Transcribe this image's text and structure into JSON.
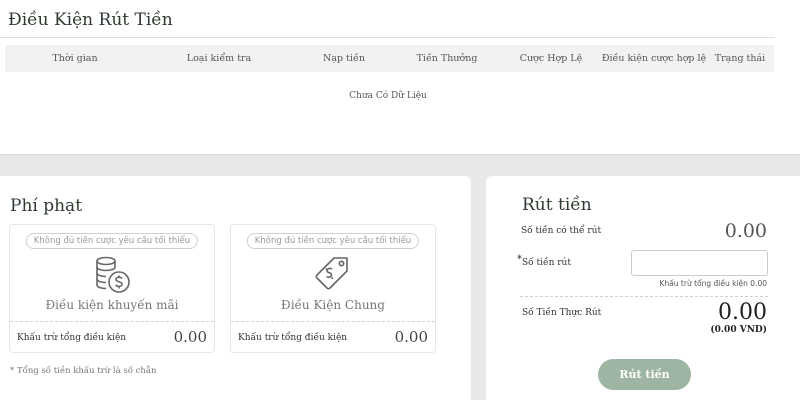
{
  "conditions": {
    "title": "Điều Kiện Rút Tiền",
    "columns": [
      "Thời gian",
      "Loại kiểm tra",
      "Nạp tiền",
      "Tiền Thưởng",
      "Cược Hợp Lệ",
      "Điều kiện cược hợp lệ",
      "Trạng thái"
    ],
    "empty_message": "Chưa Có Dữ Liệu"
  },
  "penalty": {
    "title": "Phí phạt",
    "cards": [
      {
        "pill": "Không đủ tiền cược yêu cầu tối thiểu",
        "label": "Điều kiện khuyến mãi",
        "icon": "coins-dollar-icon",
        "footer_label": "Khấu trừ tổng điều kiện",
        "footer_value": "0.00"
      },
      {
        "pill": "Không đủ tiền cược yêu cầu tối thiểu",
        "label": "Điều Kiện Chung",
        "icon": "price-tag-icon",
        "footer_label": "Khấu trừ tổng điều kiện",
        "footer_value": "0.00"
      }
    ],
    "footnote": "* Tổng số tiền khấu trừ là số chẵn"
  },
  "withdraw": {
    "title": "Rút tiền",
    "available_label": "Số tiền có thể rút",
    "available_value": "0.00",
    "amount_label": "Số tiền rút",
    "amount_required_mark": "*",
    "amount_value": "",
    "deduct_hint": "Khấu trừ tổng điều kiện 0.00",
    "actual_label": "Số Tiền Thực Rút",
    "actual_value": "0.00",
    "actual_sub": "(0.00 VND)",
    "button_label": "Rút tiền"
  },
  "colors": {
    "button": "#9fb5a3",
    "title": "#2f3b2f",
    "background": "#e8e8e8"
  }
}
